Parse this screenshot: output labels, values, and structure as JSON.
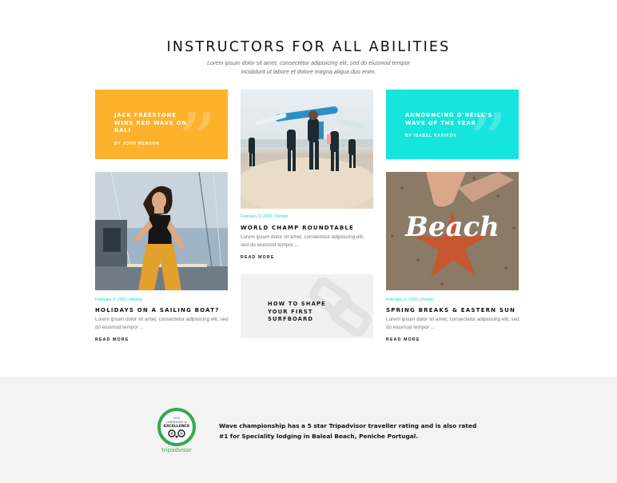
{
  "hero": {
    "title": "INSTRUCTORS FOR ALL ABILITIES",
    "subtitle": "Lorem ipsum dolor sit amet, consectetur adipisicing elit, sed do eiusmod tempor incididunt ut labore et dolore magna aliqua duo enim."
  },
  "quotes": [
    {
      "title": "JACK FREESTONE WINS RED WAVE ON BALI",
      "author": "BY JOHN MENSON",
      "color": "#fdb22b"
    },
    {
      "title": "ANNOUNCING O'NEILL'S WAVE OF THE YEAR",
      "author": "BY ISABEL KARIKOV",
      "color": "#16e5dd"
    }
  ],
  "posts": [
    {
      "meta": "February 6, 2020 / Rental",
      "title": "WORLD CHAMP ROUNDTABLE",
      "excerpt": "Lorem ipsum dolor sit amet, consectetur adipisicing elit, sed do eiusmod tempor ...",
      "read_more": "READ MORE"
    },
    {
      "meta": "February 6, 2020 / Rental",
      "title": "HOLIDAYS ON A SAILING BOAT?",
      "excerpt": "Lorem ipsum dolor sit amet, consectetur adipisicing elit, sed do eiusmod tempor ...",
      "read_more": "READ MORE"
    },
    {
      "meta": "February 6, 2020 / Rental",
      "title": "SPRING BREAKS & EASTERN SUN",
      "excerpt": "Lorem ipsum dolor sit amet, consectetur adipisicing elit, sed do eiusmod tempor ...",
      "read_more": "READ MORE"
    }
  ],
  "grey_card": {
    "title": "HOW TO SHAPE YOUR FIRST SURFBOARD"
  },
  "beach_word": "Beach",
  "badge": {
    "top_text": "CERTIFICATE of",
    "main_text": "EXCELLENCE",
    "year": "2019",
    "brand": "tripadvisor"
  },
  "award_text": "Wave championship has a 5 star Tripadvisor traveller rating and is also rated #1 for Speciality lodging in Baleal Beach, Peniche Portugal.",
  "colors": {
    "accent_cyan": "#16e5dd",
    "accent_yellow": "#fdb22b",
    "meta_text": "#16d8d0",
    "footer_bg": "#f3f3f3"
  }
}
